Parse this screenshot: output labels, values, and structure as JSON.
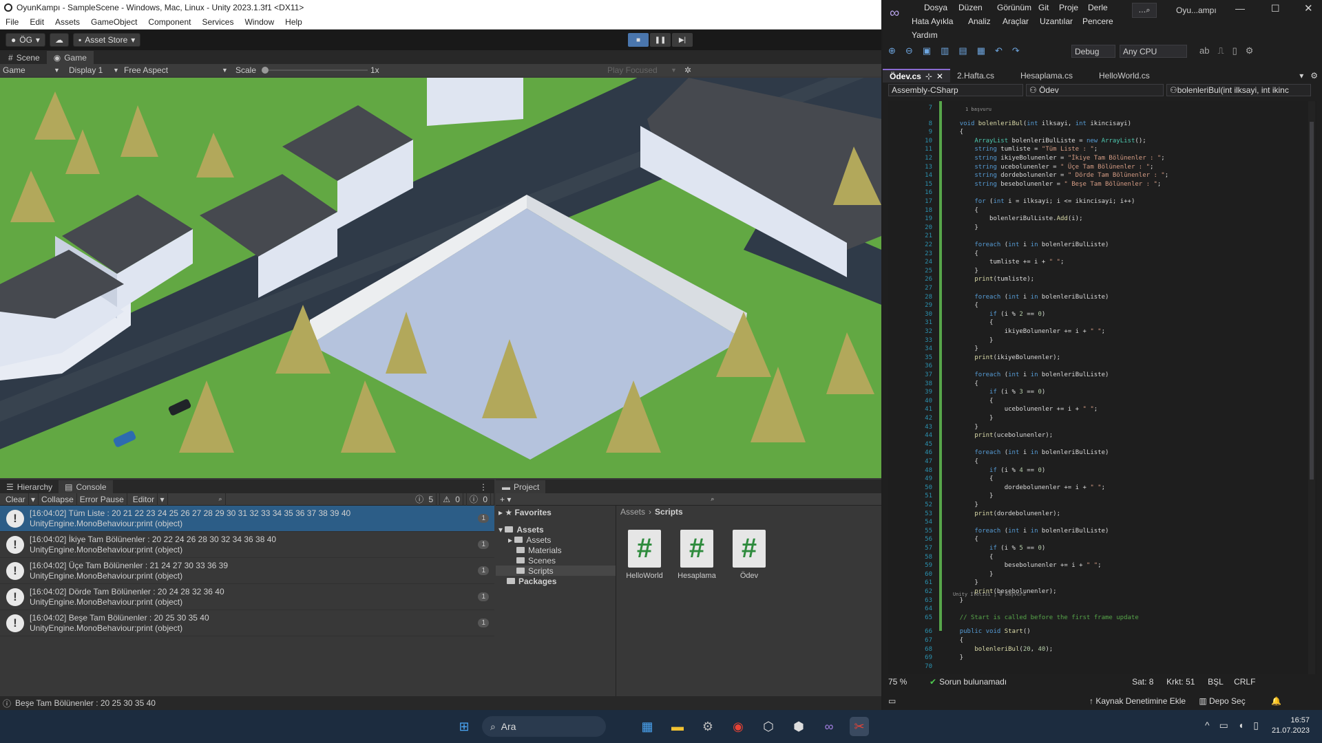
{
  "unity": {
    "title": "OyunKampı - SampleScene - Windows, Mac, Linux - Unity 2023.1.3f1 <DX11>",
    "menu": [
      "File",
      "Edit",
      "Assets",
      "GameObject",
      "Component",
      "Services",
      "Window",
      "Help"
    ],
    "toolbar": {
      "account": "ÖG",
      "asset_store": "Asset Store"
    },
    "view_tabs": [
      "Scene",
      "Game"
    ],
    "game_bar": {
      "mode": "Game",
      "display": "Display 1",
      "aspect": "Free Aspect",
      "scale_label": "Scale",
      "scale_value": "1x",
      "play_focused": "Play Focused"
    },
    "console": {
      "tabs": [
        "Hierarchy",
        "Console"
      ],
      "toolbar": {
        "clear": "Clear",
        "collapse": "Collapse",
        "error_pause": "Error Pause",
        "editor": "Editor",
        "log_count": "5",
        "warn_count": "0",
        "error_count": "0"
      },
      "entries": [
        {
          "line1": "[16:04:02] Tüm Liste : 20 21 22 23 24 25 26 27 28 29 30 31 32 33 34 35 36 37 38 39 40",
          "line2": "UnityEngine.MonoBehaviour:print (object)",
          "count": "1"
        },
        {
          "line1": "[16:04:02] İkiye Tam Bölünenler : 20 22 24 26 28 30 32 34 36 38 40",
          "line2": "UnityEngine.MonoBehaviour:print (object)",
          "count": "1"
        },
        {
          "line1": "[16:04:02]  Üçe Tam Bölünenler : 21 24 27 30 33 36 39",
          "line2": "UnityEngine.MonoBehaviour:print (object)",
          "count": "1"
        },
        {
          "line1": "[16:04:02]  Dörde Tam Bölünenler : 20 24 28 32 36 40",
          "line2": "UnityEngine.MonoBehaviour:print (object)",
          "count": "1"
        },
        {
          "line1": "[16:04:02]  Beşe Tam Bölünenler : 20 25 30 35 40",
          "line2": "UnityEngine.MonoBehaviour:print (object)",
          "count": "1"
        }
      ]
    },
    "project": {
      "tab": "Project",
      "tree": {
        "favorites": "Favorites",
        "assets": "Assets",
        "children": [
          "Assets",
          "Materials",
          "Scenes",
          "Scripts"
        ],
        "packages": "Packages"
      },
      "breadcrumb": [
        "Assets",
        "Scripts"
      ],
      "files": [
        "HelloWorld",
        "Hesaplama",
        "Ödev"
      ]
    },
    "status": "Beşe Tam Bölünenler : 20 25 30 35 40"
  },
  "vs": {
    "menu": [
      "Dosya",
      "Düzen",
      "Görünüm",
      "Git",
      "Proje",
      "Derle",
      "Hata Ayıkla",
      "Analiz",
      "Araçlar",
      "Uzantılar",
      "Pencere",
      "Yardım"
    ],
    "search_label": "Oyu...ampı",
    "config": "Debug",
    "platform": "Any CPU",
    "tabs": [
      "Ödev.cs",
      "2.Hafta.cs",
      "Hesaplama.cs",
      "HelloWorld.cs"
    ],
    "nav": {
      "project": "Assembly-CSharp",
      "class": "Ödev",
      "member": "bolenleriBul(int ilksayi, int ikinc"
    },
    "refs_hint": "1 başvuru",
    "unity_hint": "Unity İletisi | 0 başvuru",
    "status": {
      "zoom": "75 %",
      "issues": "Sorun bulunamadı",
      "line": "Sat: 8",
      "col": "Krkt: 51",
      "spacing": "BŞL",
      "eol": "CRLF"
    },
    "bottom": {
      "source_control": "Kaynak Denetimine Ekle",
      "repo": "Depo Seç"
    }
  },
  "taskbar": {
    "search": "Ara",
    "time": "16:57",
    "date": "21.07.2023"
  },
  "colors": {
    "unity_bg": "#383838",
    "selected_row": "#2c5d87",
    "vs_accent": "#8a6bd1",
    "taskbar": "#1c2c3f"
  }
}
